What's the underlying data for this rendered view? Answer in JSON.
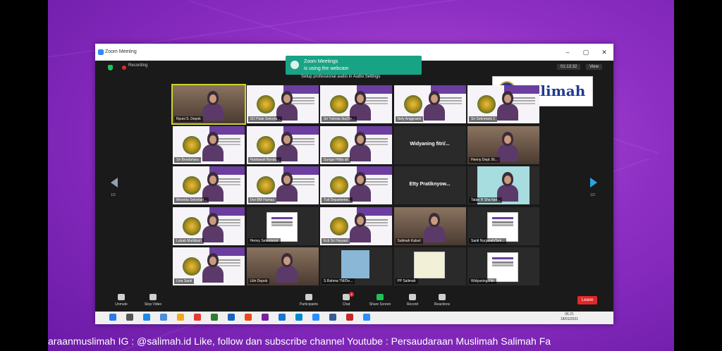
{
  "window": {
    "title": "Zoom Meeting",
    "controls": [
      "–",
      "▢",
      "✕"
    ]
  },
  "topbar": {
    "recording_label": "Recording",
    "timer": "01:13:32",
    "view_label": "View"
  },
  "notification": {
    "line1": "Zoom Meetings",
    "line2": "is using the webcam",
    "subnote": "Setup professional audio in Audio Settings"
  },
  "brand": {
    "name": "Salimah",
    "color": "#1f3a93"
  },
  "pagination": {
    "left": "1/2",
    "right": "1/2"
  },
  "participants": [
    {
      "label": "Nyuni S. Depok",
      "kind": "person-room",
      "speaking": true
    },
    {
      "label": "SO Pdak Sekreta...",
      "kind": "slide"
    },
    {
      "label": "Sri Yulinda Ibu/De...",
      "kind": "slide"
    },
    {
      "label": "Nely Anggraeni",
      "kind": "slide"
    },
    {
      "label": "Sri Sekretaris 1",
      "kind": "slide"
    },
    {
      "label": "Sri Bendahara",
      "kind": "slide"
    },
    {
      "label": "Hadiawati Bandu...",
      "kind": "slide"
    },
    {
      "label": "Sungai Hilda ali",
      "kind": "slide"
    },
    {
      "label": "",
      "kind": "name",
      "name": "Widyaning fitri/..."
    },
    {
      "label": "Henny Dept. Bi...",
      "kind": "person-room"
    },
    {
      "label": "Mesrida Sekretari...",
      "kind": "slide"
    },
    {
      "label": "Dwi BM Humas",
      "kind": "slide"
    },
    {
      "label": "Tuti Departeme...",
      "kind": "slide"
    },
    {
      "label": "",
      "kind": "name",
      "name": "Etty Pratiknyow..."
    },
    {
      "label": "Tatan R Sha hari...",
      "kind": "teal"
    },
    {
      "label": "Lubab Mutibbah",
      "kind": "slide"
    },
    {
      "label": "Henny Sekretariat",
      "kind": "whiteslide"
    },
    {
      "label": "Ecti Sri Haryani",
      "kind": "slide"
    },
    {
      "label": "Salimah Kalsel",
      "kind": "person-room"
    },
    {
      "label": "Santi Nurjanah/Sek...",
      "kind": "whiteslide"
    },
    {
      "label": "Lina Santi",
      "kind": "slide"
    },
    {
      "label": "Lilin Depok",
      "kind": "person-room"
    },
    {
      "label": "S.Rahma TM/De...",
      "kind": "bluephoto"
    },
    {
      "label": "PP Salimah",
      "kind": "paper"
    },
    {
      "label": "Widyaning Fitri",
      "kind": "whiteslide"
    }
  ],
  "controls": [
    {
      "label": "Unmute",
      "icon": "mic-off-icon"
    },
    {
      "label": "Stop Video",
      "icon": "video-icon"
    },
    {
      "label": "Participants",
      "icon": "participants-icon",
      "count": "33"
    },
    {
      "label": "Chat",
      "icon": "chat-icon",
      "badge": "4"
    },
    {
      "label": "Share Screen",
      "icon": "share-screen-icon"
    },
    {
      "label": "Record",
      "icon": "record-icon"
    },
    {
      "label": "Reactions",
      "icon": "reactions-icon"
    }
  ],
  "leave_label": "Leave",
  "taskbar": {
    "time": "06.21",
    "date": "18/01/2021"
  },
  "ticker": "araanmuslimah    IG : @salimah.id        Like, follow dan subscribe channel Youtube : Persaudaraan Muslimah Salimah    Fa"
}
